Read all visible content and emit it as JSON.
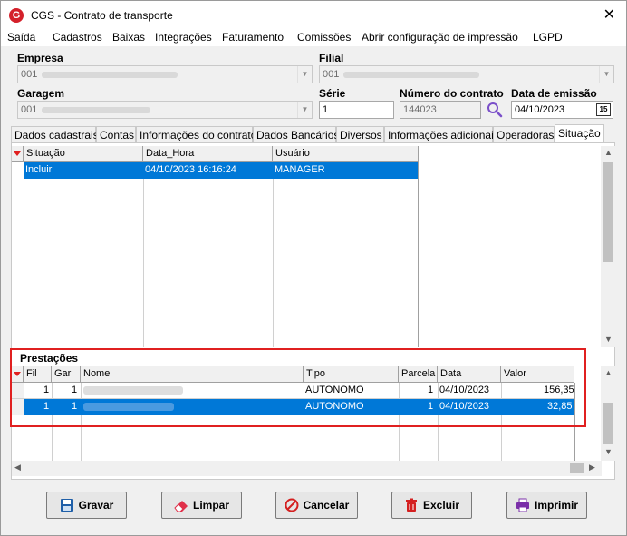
{
  "window": {
    "title": "CGS - Contrato de transporte",
    "logo_letter": "G"
  },
  "menu": [
    "Saída",
    "Cadastros",
    "Baixas",
    "Integrações",
    "Faturamento",
    "Comissões",
    "Abrir configuração de impressão",
    "LGPD"
  ],
  "form": {
    "empresa_label": "Empresa",
    "empresa_value": "001",
    "filial_label": "Filial",
    "filial_value": "001",
    "garagem_label": "Garagem",
    "garagem_value": "001",
    "serie_label": "Série",
    "serie_value": "1",
    "numero_label": "Número do contrato",
    "numero_value": "144023",
    "data_label": "Data de emissão",
    "data_value": "04/10/2023",
    "calendar_glyph": "15"
  },
  "tabs": [
    "Dados cadastrais",
    "Contas",
    "Informações do contrato",
    "Dados Bancários",
    "Diversos",
    "Informações adicionais",
    "Operadoras",
    "Situação"
  ],
  "active_tab": "Situação",
  "situacao_grid": {
    "columns": [
      "Situação",
      "Data_Hora",
      "Usuário"
    ],
    "rows": [
      {
        "situacao": "Incluir",
        "data_hora": "04/10/2023 16:16:24",
        "usuario": "MANAGER"
      }
    ]
  },
  "prestacoes": {
    "title": "Prestações",
    "columns": [
      "Fil",
      "Gar",
      "Nome",
      "Tipo",
      "Parcela",
      "Data",
      "Valor"
    ],
    "rows": [
      {
        "fil": "1",
        "gar": "1",
        "nome": "",
        "tipo": "AUTONOMO",
        "parcela": "1",
        "data": "04/10/2023",
        "valor": "156,35"
      },
      {
        "fil": "1",
        "gar": "1",
        "nome": "",
        "tipo": "AUTONOMO",
        "parcela": "1",
        "data": "04/10/2023",
        "valor": "32,85"
      }
    ]
  },
  "buttons": {
    "gravar": "Gravar",
    "limpar": "Limpar",
    "cancelar": "Cancelar",
    "excluir": "Excluir",
    "imprimir": "Imprimir"
  },
  "colors": {
    "accent": "#0078d7",
    "highlight_box": "#e02020",
    "logo": "#d4202a"
  }
}
